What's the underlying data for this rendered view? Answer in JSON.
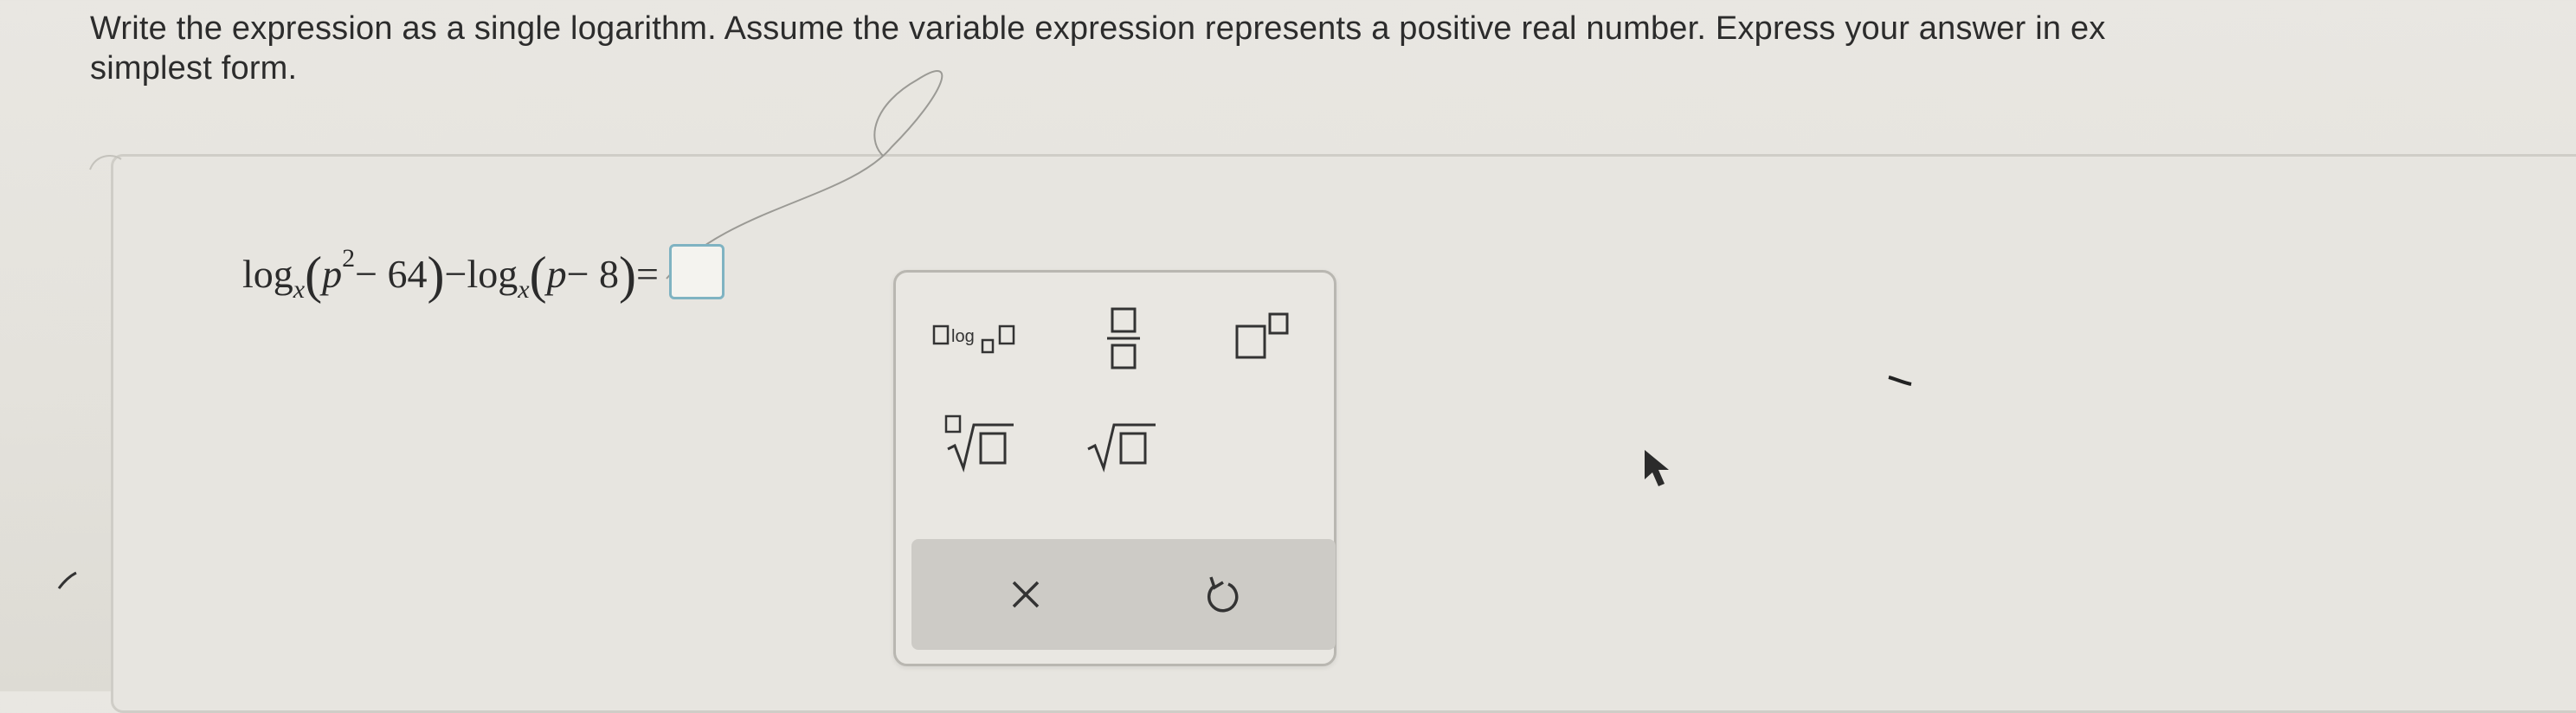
{
  "instructions": {
    "line1": "Write the expression as a single logarithm. Assume the variable expression represents a positive real number. Express your answer in ex",
    "line2": "simplest form."
  },
  "equation": {
    "log1": "log",
    "base1": "x",
    "open1": "(",
    "var1": "p",
    "exp1": "2",
    "term1": " − 64",
    "close1": ")",
    "minus": " − ",
    "log2": "log",
    "base2": "x",
    "open2": "(",
    "var2": "p",
    "term2": " − 8",
    "close2": ")",
    "equals": " = "
  },
  "answer": {
    "value": ""
  },
  "palette": {
    "log_label": "log",
    "tools": [
      "log-base-icon",
      "fraction-icon",
      "exponent-icon",
      "nth-root-icon",
      "square-root-icon"
    ],
    "actions": [
      "clear-icon",
      "undo-icon"
    ]
  },
  "colors": {
    "background": "#e7e5e0",
    "accent": "#7fb3c2",
    "icon": "#2f2f2f",
    "action_bar": "#cdcbc6"
  }
}
